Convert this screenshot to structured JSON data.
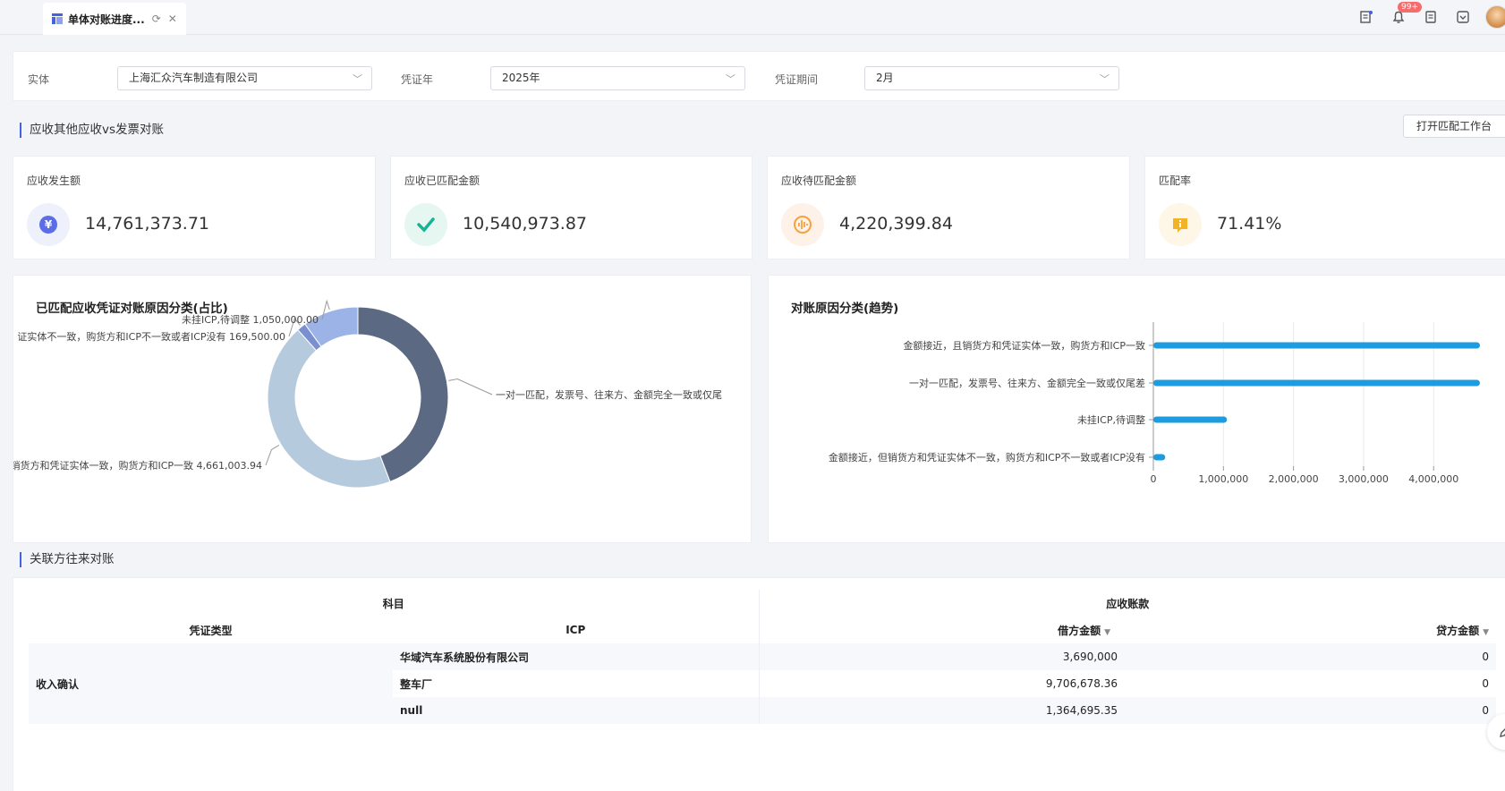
{
  "tab": {
    "title": "单体对账进度..."
  },
  "header": {
    "notification_badge": "99+"
  },
  "filters": {
    "entity_label": "实体",
    "entity_value": "上海汇众汽车制造有限公司",
    "year_label": "凭证年",
    "year_value": "2025年",
    "period_label": "凭证期间",
    "period_value": "2月"
  },
  "section1": {
    "title": "应收其他应收vs发票对账",
    "open_button": "打开匹配工作台"
  },
  "kpis": [
    {
      "label": "应收发生额",
      "value": "14,761,373.71",
      "icon": "yuan-icon",
      "color": "#5b6ee8",
      "bg": "#eef0fc"
    },
    {
      "label": "应收已匹配金额",
      "value": "10,540,973.87",
      "icon": "check-icon",
      "color": "#19b394",
      "bg": "#e6f7f2"
    },
    {
      "label": "应收待匹配金额",
      "value": "4,220,399.84",
      "icon": "waveform-icon",
      "color": "#f5a23c",
      "bg": "#fdf1e8"
    },
    {
      "label": "匹配率",
      "value": "71.41%",
      "icon": "info-message-icon",
      "color": "#f3b327",
      "bg": "#fef6e6"
    }
  ],
  "pie_panel": {
    "title": "已匹配应收凭证对账原因分类(占比)"
  },
  "bar_panel": {
    "title": "对账原因分类(趋势)"
  },
  "chart_data": [
    {
      "type": "pie",
      "title": "已匹配应收凭证对账原因分类(占比)",
      "categories": [
        "一对一匹配，发票号、往来方、金额完全一致或仅尾差",
        "金额接近，且销售方和凭证实体一致，购货方和ICP一致",
        "金额接近，但销售方和凭证实体不一致，购货方和ICP不一致或者ICP没有",
        "未挂ICP,待调整"
      ],
      "labels": [
        "一对一匹配，发票号、往来方、金额完全一致或仅尾",
        "销货方和凭证实体一致，购货方和ICP一致 4,661,003.94",
        "证实体不一致，购货方和ICP不一致或者ICP没有 169,500.00",
        "未挂ICP,待调整 1,050,000.00"
      ],
      "values": [
        4660469.93,
        4661003.94,
        169500.0,
        1050000.0
      ],
      "colors": [
        "#5b6a82",
        "#b5cbdd",
        "#7a8fcf",
        "#9cb3e8"
      ]
    },
    {
      "type": "bar",
      "title": "对账原因分类(趋势)",
      "categories": [
        "金额接近，且销货方和凭证实体一致，购货方和ICP一致",
        "一对一匹配，发票号、往来方、金额完全一致或仅尾差",
        "未挂ICP,待调整",
        "金额接近，但销货方和凭证实体不一致，购货方和ICP不一致或者ICP没有"
      ],
      "values": [
        4661003.94,
        4660469.93,
        1050000.0,
        169500.0
      ],
      "xlim": [
        0,
        4661003.94
      ],
      "xticks": [
        "0",
        "1,000,000",
        "2,000,000",
        "3,000,000",
        "4,000,000"
      ],
      "color": "#1f9be0"
    }
  ],
  "section2": {
    "title": "关联方往来对账"
  },
  "table": {
    "group_left": "科目",
    "group_right": "应收账款",
    "col_type": "凭证类型",
    "col_icp": "ICP",
    "col_debit": "借方金额",
    "col_credit": "贷方金额",
    "type_value": "收入确认",
    "rows": [
      {
        "icp": "华域汽车系统股份有限公司",
        "debit": "3,690,000",
        "credit": "0"
      },
      {
        "icp": "整车厂",
        "debit": "9,706,678.36",
        "credit": "0"
      },
      {
        "icp": "null",
        "debit": "1,364,695.35",
        "credit": "0"
      }
    ]
  }
}
